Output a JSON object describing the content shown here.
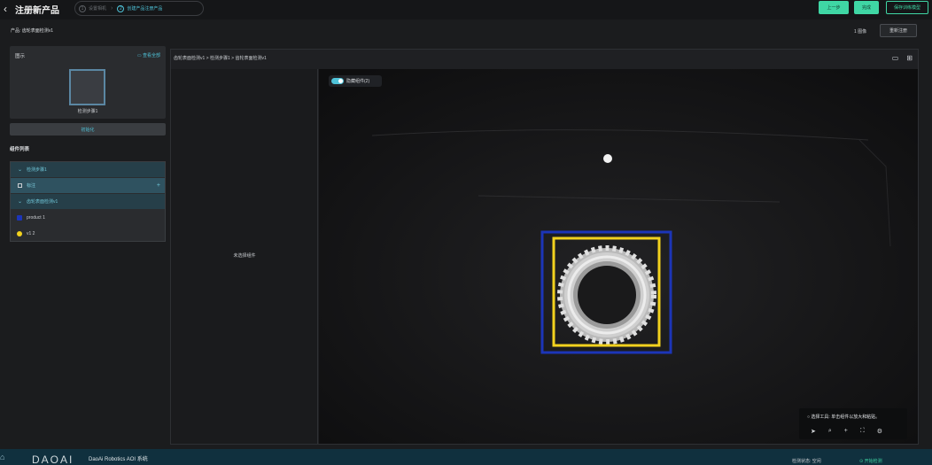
{
  "header": {
    "back_icon": "chevron-left-icon",
    "title": "注册新产品",
    "steps": [
      {
        "num": "1",
        "label": "设置相机"
      },
      {
        "num": "2",
        "label": "创建产品注册产品"
      }
    ],
    "prev_label": "上一步",
    "done_label": "完成",
    "save_label": "保存训练模型"
  },
  "product_row": {
    "product_label": "产品: 齿轮表面检测v1",
    "image_count": "1 图像",
    "reregister_label": "重新注册"
  },
  "left": {
    "graphic_title": "图示",
    "view_all": "查看全部",
    "thumb_label": "检测步骤1",
    "reset_label": "初始化",
    "parts_title": "组件列表",
    "tree": [
      {
        "label": "检测步骤1"
      },
      {
        "label": "标注"
      },
      {
        "label": "齿轮表面检测v1"
      },
      {
        "label": "product 1",
        "color": "#1c35b8"
      },
      {
        "label": "v1 2",
        "color": "#f2d21e"
      }
    ]
  },
  "main": {
    "breadcrumb": "齿轮表面检测v1 > 检测步骤1 > 齿轮表面检测v1",
    "view_icons": [
      "single-view-icon",
      "grid-view-icon"
    ],
    "no_select": "未选择组件",
    "hide_toggle_label": "隐藏组件(2)",
    "tool_hint": "选择工具: 单击组件以放大和粘贴。",
    "tools": [
      "pointer-icon",
      "zoom-icon",
      "crosshair-icon",
      "fit-icon",
      "settings-icon"
    ]
  },
  "footer": {
    "logo": "DAOAI",
    "system_name": "DaoAi Robotics AOI 系统",
    "status": "检测状态: 空闲",
    "start": "开始检测"
  },
  "colors": {
    "accent": "#4fc3d9",
    "green": "#3fd6a4",
    "blue_box": "#1c35b8",
    "yellow_box": "#f2d21e"
  }
}
